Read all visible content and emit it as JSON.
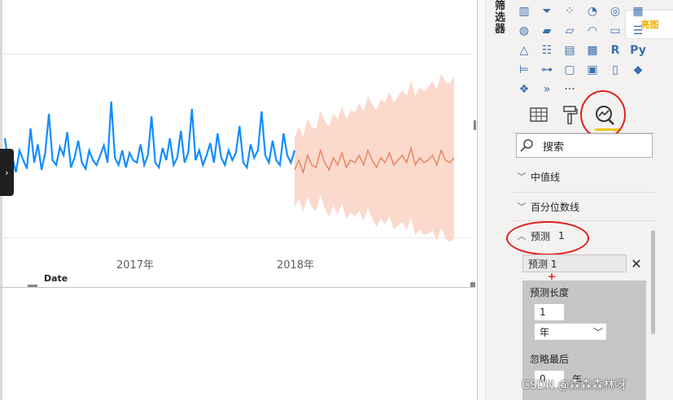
{
  "panes": {
    "filters_label": "筛选器"
  },
  "chart": {
    "x_axis_title": "Date",
    "tick_labels": [
      "2017年",
      "2018年"
    ],
    "actual_color": "#118dff",
    "forecast_color": "#e8805a",
    "forecast_band_color": "#fbd9cc"
  },
  "chart_data": {
    "type": "line",
    "xlabel": "Date",
    "x_ticks": [
      "2017年",
      "2018年"
    ],
    "series": [
      {
        "values": [
          40,
          18,
          25,
          12,
          30,
          22,
          15,
          48,
          20,
          35,
          14,
          28,
          60,
          22,
          18,
          33,
          26,
          45,
          16,
          24,
          38,
          20,
          15,
          30,
          22,
          18,
          26,
          34,
          20,
          70,
          24,
          18,
          30,
          16,
          28,
          22,
          20,
          35,
          18,
          26,
          58,
          20,
          16,
          32,
          22,
          40,
          18,
          24,
          46,
          20,
          28,
          64,
          22,
          30,
          18,
          26,
          36,
          20,
          44,
          24,
          18,
          30,
          22,
          28,
          50,
          20,
          16,
          35,
          24,
          30,
          62,
          26,
          20,
          38,
          22,
          18,
          44,
          26,
          20,
          30
        ]
      },
      {
        "values": [
          14,
          22,
          12,
          26,
          18,
          16,
          30,
          20,
          14,
          24,
          18,
          28,
          16,
          22,
          20,
          26,
          18,
          30,
          22,
          16,
          24,
          20,
          28,
          18,
          22,
          26,
          20,
          32,
          18,
          24,
          20,
          22,
          26,
          18,
          30,
          22,
          20,
          24
        ]
      }
    ]
  },
  "viz_pane": {
    "icons": [
      "column-chart-icon",
      "funnel-icon",
      "scatter-chart-icon",
      "pie-chart-icon",
      "donut-chart-icon",
      "treemap-icon",
      "map-icon",
      "filled-map-icon",
      "shape-map-icon",
      "gauge-icon",
      "card-icon",
      "multi-row-card-icon",
      "kpi-icon",
      "slicer-icon",
      "table-icon",
      "matrix-icon",
      "r-visual-icon",
      "python-visual-icon",
      "key-influencers-icon",
      "decomposition-tree-icon",
      "qa-icon",
      "narrative-icon",
      "paginated-report-icon",
      "powerapps-icon",
      "power-automate-icon",
      "more-visuals-icon",
      "ellipsis-icon"
    ],
    "r_label": "R",
    "py_label": "Py",
    "more_label": "···",
    "brand_text": "亮图"
  },
  "tabs": {
    "fields_icon": "fields-icon",
    "format_icon": "format-paint-icon",
    "analytics_icon": "analytics-icon"
  },
  "search": {
    "placeholder": "搜索"
  },
  "sections": {
    "median_line": "中值线",
    "percentile_line": "百分位数线",
    "forecast": "预测",
    "forecast_count": "1"
  },
  "forecast_panel": {
    "name_value": "预测 1",
    "length_label": "预测长度",
    "length_value": "1",
    "unit_value": "年",
    "ignore_last_label": "忽略最后",
    "ignore_value": "0",
    "ignore_unit": "年"
  },
  "watermark": "CSDN @森森森林呀"
}
